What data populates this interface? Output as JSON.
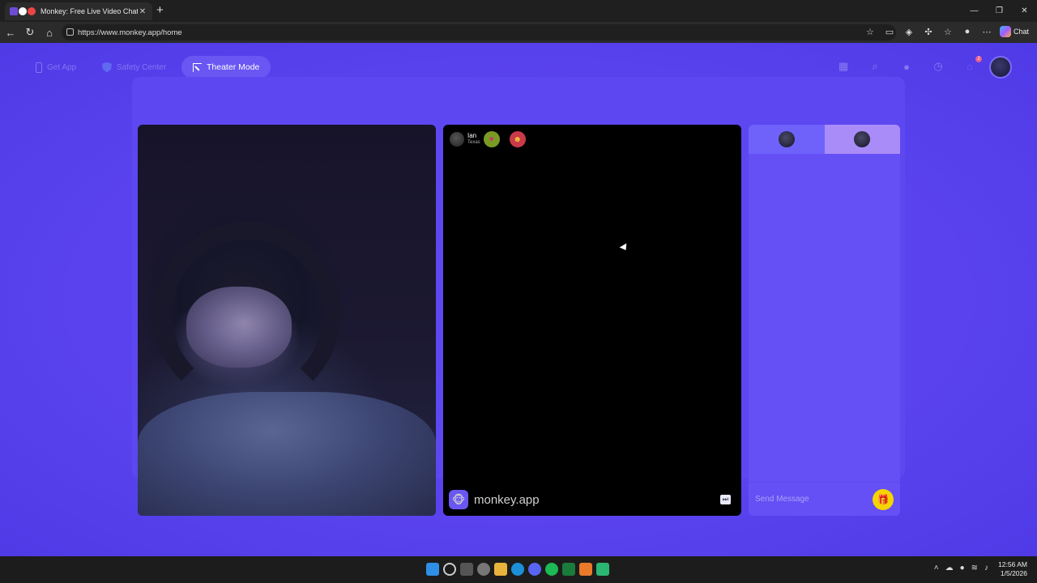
{
  "browser": {
    "tab_title": "Monkey: Free Live Video Chat",
    "tab_close": "✕",
    "new_tab": "+",
    "url": "https://www.monkey.app/home",
    "chat_button": "Chat",
    "window_controls": [
      "—",
      "❐",
      "✕"
    ]
  },
  "topnav": {
    "get_app": "Get App",
    "safety_center": "Safety Center",
    "theater_mode": "Theater Mode",
    "notification_count": "2"
  },
  "peer": {
    "name": "Ian",
    "location": "Texas"
  },
  "watermark": "monkey.app",
  "chat": {
    "placeholder": "Send Message"
  },
  "taskbar": {
    "time": "12:56 AM",
    "date": "1/5/2026"
  },
  "colors": {
    "page_bg": "#5a43ef",
    "panel": "#6450f4",
    "gift": "#f6d400",
    "active_pill": "#6a56f3"
  }
}
